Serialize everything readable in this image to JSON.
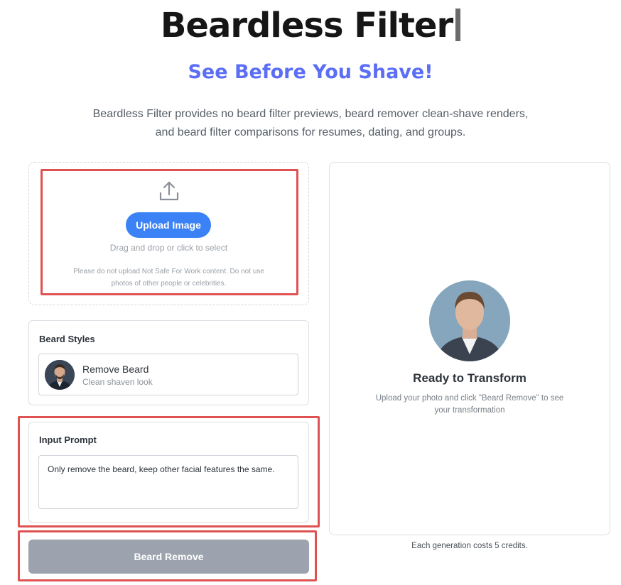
{
  "header": {
    "title": "Beardless Filter",
    "subtitle": "See Before You Shave!",
    "description": "Beardless Filter provides no beard filter previews, beard remover clean-shave renders, and beard filter comparisons for resumes, dating, and groups."
  },
  "upload": {
    "icon": "upload-icon",
    "button_label": "Upload Image",
    "drag_text": "Drag and drop or click to select",
    "notice": "Please do not upload Not Safe For Work content. Do not use photos of other people or celebrities."
  },
  "beard_styles": {
    "title": "Beard Styles",
    "items": [
      {
        "name": "Remove Beard",
        "description": "Clean shaven look"
      }
    ]
  },
  "prompt": {
    "title": "Input Prompt",
    "value": "Only remove the beard, keep other facial features the same."
  },
  "action": {
    "button_label": "Beard Remove"
  },
  "preview": {
    "title": "Ready to Transform",
    "description": "Upload your photo and click \"Beard Remove\" to see your transformation",
    "credits_note": "Each generation costs 5 credits."
  },
  "colors": {
    "accent": "#3b82f6",
    "subtitle": "#5b6ef5",
    "disabled_button": "#9ca3af",
    "highlight": "#e05252"
  }
}
